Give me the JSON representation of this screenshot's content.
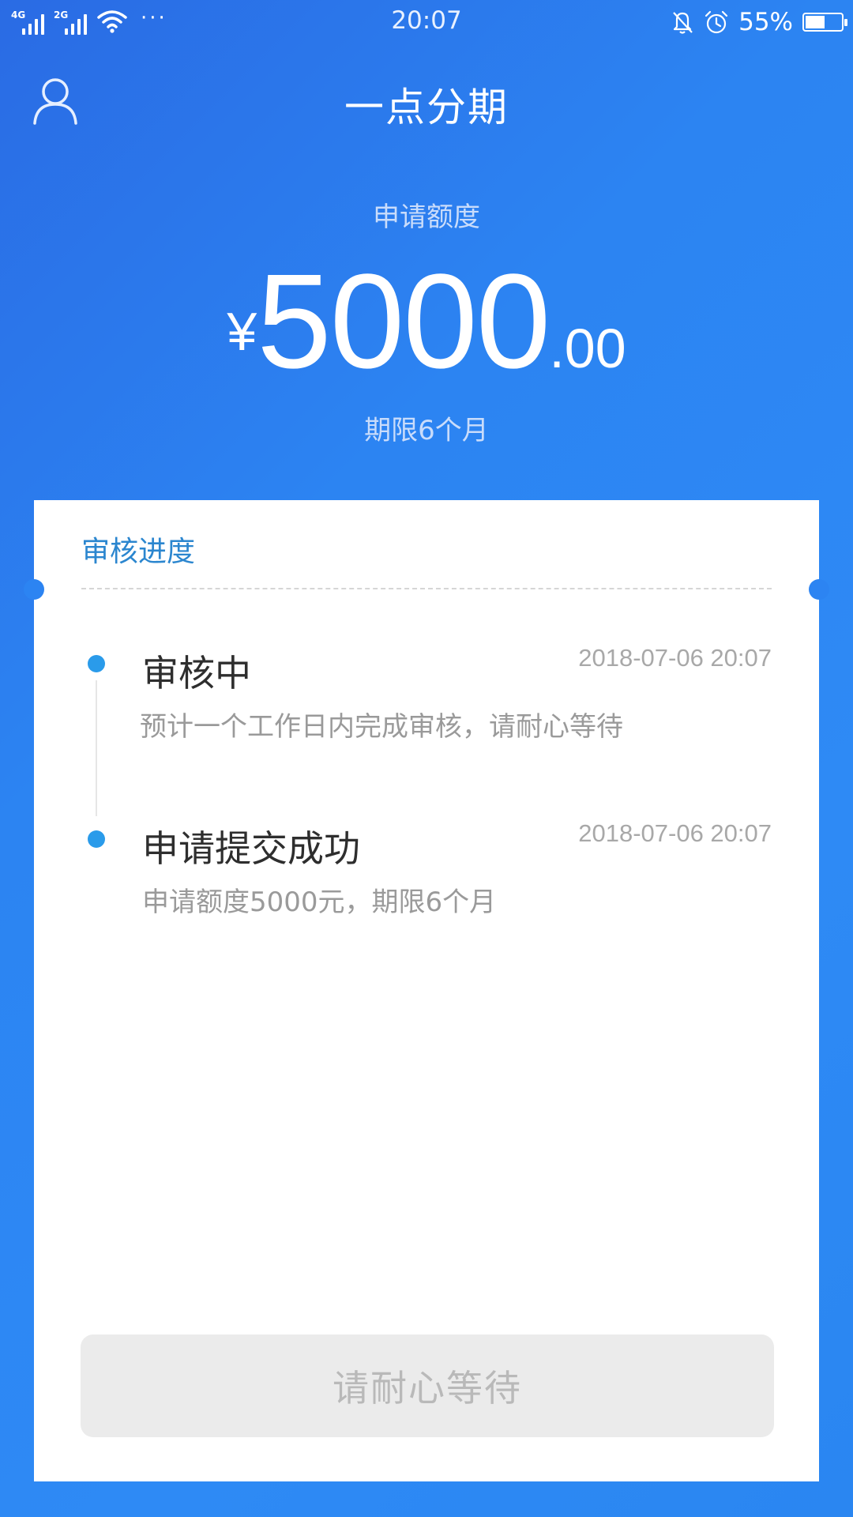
{
  "status_bar": {
    "network_1": "4G",
    "network_2": "2G",
    "more_indicator": "···",
    "time": "20:07",
    "battery_percent": "55%",
    "battery_level": 0.55,
    "icons": [
      "signal-icon",
      "wifi-icon",
      "bell-muted-icon",
      "alarm-icon",
      "battery-icon"
    ]
  },
  "header": {
    "title": "一点分期",
    "user_icon": "user-icon"
  },
  "amount_section": {
    "label": "申请额度",
    "currency": "¥",
    "integer": "5000",
    "decimal": ".00",
    "term": "期限6个月"
  },
  "progress_card": {
    "title": "审核进度",
    "steps": [
      {
        "title": "审核中",
        "time": "2018-07-06 20:07",
        "description": "预计一个工作日内完成审核，请耐心等待"
      },
      {
        "title": "申请提交成功",
        "time": "2018-07-06 20:07",
        "description": "申请额度5000元，期限6个月"
      }
    ],
    "button_label": "请耐心等待"
  },
  "colors": {
    "background": "#2c84f2",
    "accent": "#2a9bea",
    "card_title": "#2b86cf"
  }
}
